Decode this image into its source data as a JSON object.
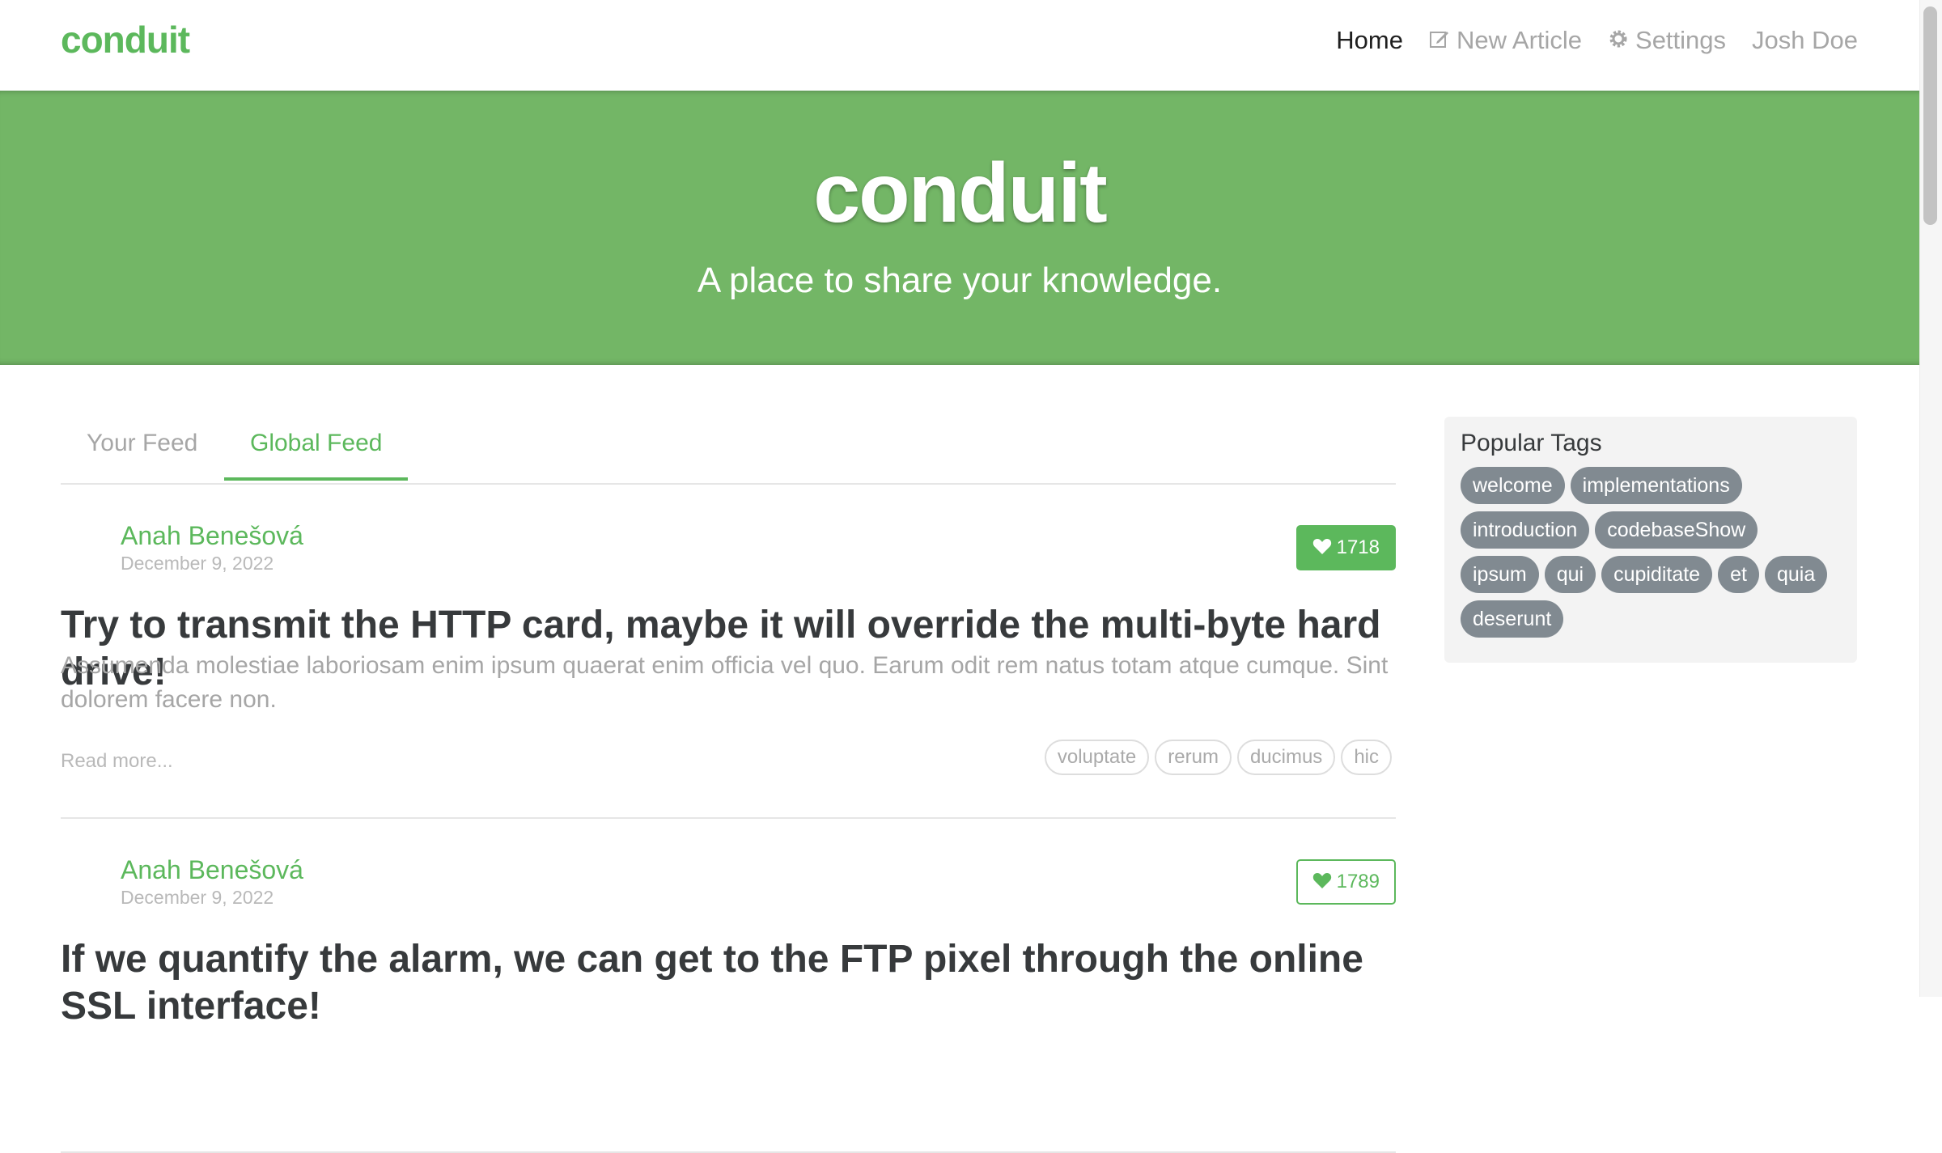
{
  "nav": {
    "brand": "conduit",
    "links": [
      {
        "label": "Home",
        "icon": ""
      },
      {
        "label": "New Article",
        "icon": "compose-icon"
      },
      {
        "label": "Settings",
        "icon": "gear-icon"
      },
      {
        "label": "Josh Doe",
        "icon": ""
      }
    ]
  },
  "banner": {
    "title": "conduit",
    "subtitle": "A place to share your knowledge."
  },
  "feed": {
    "tabs": [
      "Your Feed",
      "Global Feed"
    ],
    "active_tab": "Global Feed",
    "articles": [
      {
        "author": "Anah Benešová",
        "date": "December 9, 2022",
        "favorites": "1718",
        "favorited": true,
        "title": "Try to transmit the HTTP card, maybe it will override the multi-byte hard drive!",
        "description": "Assumenda molestiae laboriosam enim ipsum quaerat enim officia vel quo. Earum odit rem natus totam atque cumque. Sint dolorem facere non.",
        "read_more": "Read more...",
        "tags": [
          "voluptate",
          "rerum",
          "ducimus",
          "hic"
        ]
      },
      {
        "author": "Anah Benešová",
        "date": "December 9, 2022",
        "favorites": "1789",
        "favorited": false,
        "title": "If we quantify the alarm, we can get to the FTP pixel through the online SSL interface!"
      }
    ]
  },
  "sidebar": {
    "title": "Popular Tags",
    "tags": [
      "welcome",
      "implementations",
      "introduction",
      "codebaseShow",
      "ipsum",
      "qui",
      "cupiditate",
      "et",
      "quia",
      "deserunt"
    ]
  },
  "colors": {
    "brand": "#5cb85c",
    "banner": "#73b666",
    "tag_pill": "#818a91"
  }
}
